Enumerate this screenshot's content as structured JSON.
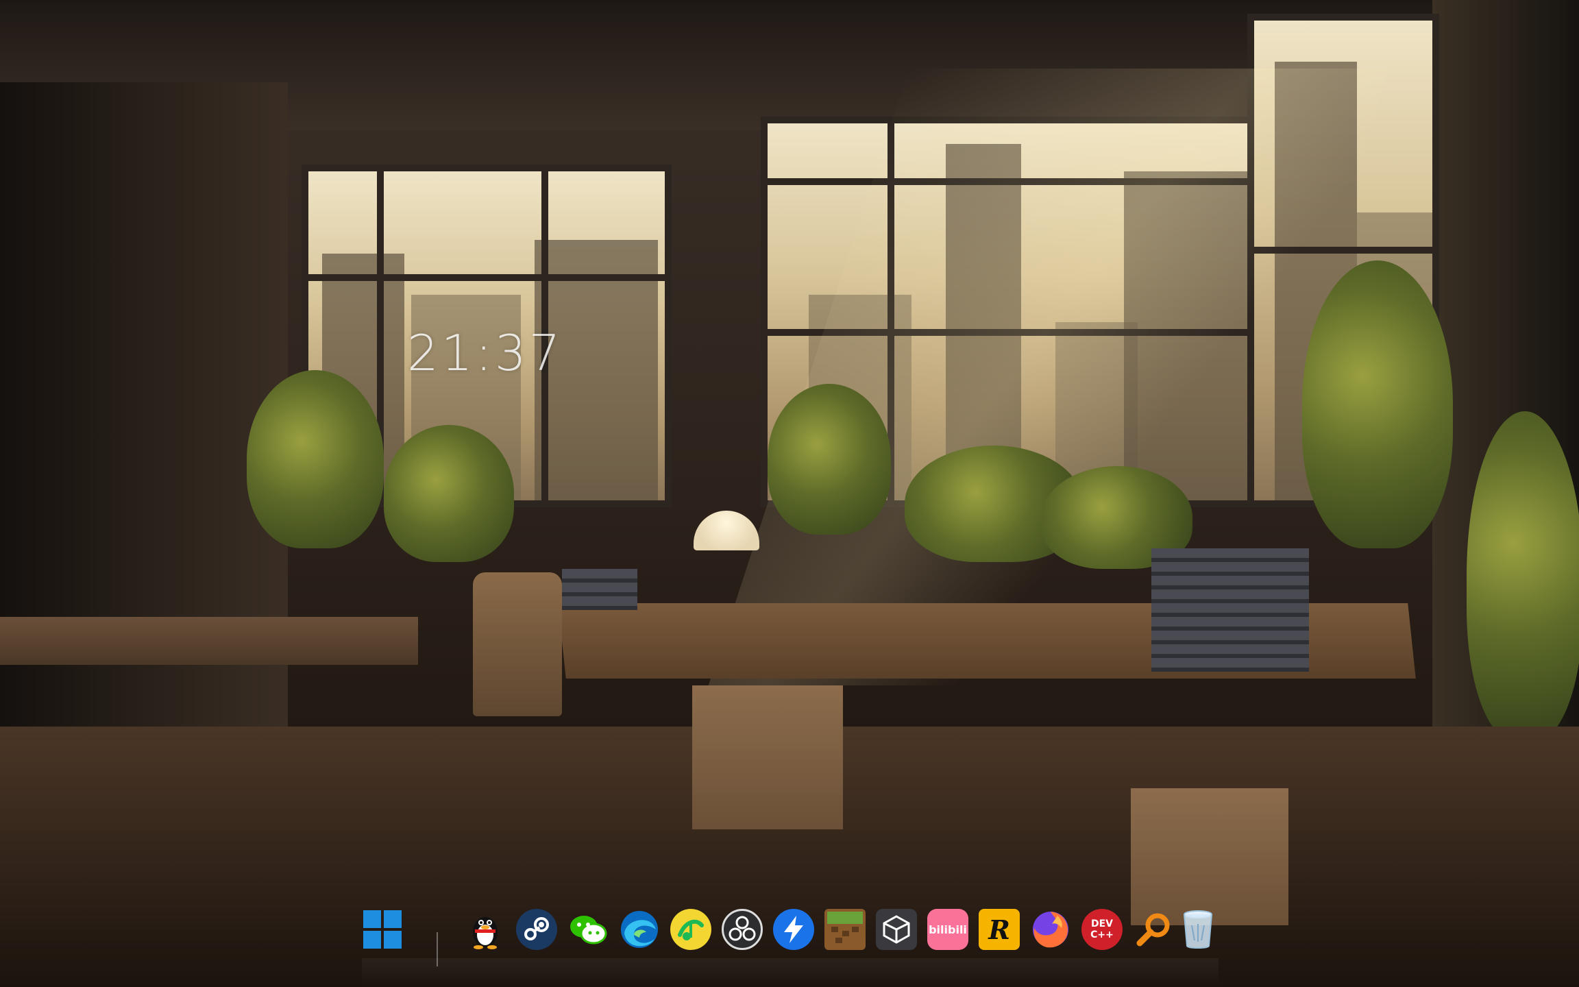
{
  "desktop": {
    "clock_time": "21:37"
  },
  "dock": {
    "items": [
      {
        "id": "start",
        "icon": "windows-start-icon"
      },
      {
        "id": "qq",
        "icon": "qq-penguin-icon"
      },
      {
        "id": "steam",
        "icon": "steam-icon"
      },
      {
        "id": "wechat",
        "icon": "wechat-icon"
      },
      {
        "id": "edge",
        "icon": "edge-browser-icon"
      },
      {
        "id": "music",
        "icon": "music-app-icon"
      },
      {
        "id": "obs",
        "icon": "obs-studio-icon"
      },
      {
        "id": "thunder",
        "icon": "thunder-download-icon"
      },
      {
        "id": "minecraft",
        "icon": "minecraft-icon"
      },
      {
        "id": "unity",
        "icon": "unity-icon"
      },
      {
        "id": "bilibili",
        "icon": "bilibili-icon",
        "label": "bilibili"
      },
      {
        "id": "rockstar",
        "icon": "rockstar-icon",
        "label": "R"
      },
      {
        "id": "firefox",
        "icon": "firefox-icon"
      },
      {
        "id": "devcpp",
        "icon": "devcpp-icon",
        "label_top": "DEV",
        "label_bottom": "C++"
      },
      {
        "id": "search",
        "icon": "search-icon"
      },
      {
        "id": "recycle-bin",
        "icon": "recycle-bin-icon"
      }
    ]
  },
  "colors": {
    "windows_blue": "#1e8fe0",
    "steam": "#1b3a63",
    "wechat": "#2dc100",
    "bilibili": "#fb7299",
    "rockstar": "#f6b400",
    "devcpp": "#d0202a",
    "thunder": "#1a73e8"
  }
}
